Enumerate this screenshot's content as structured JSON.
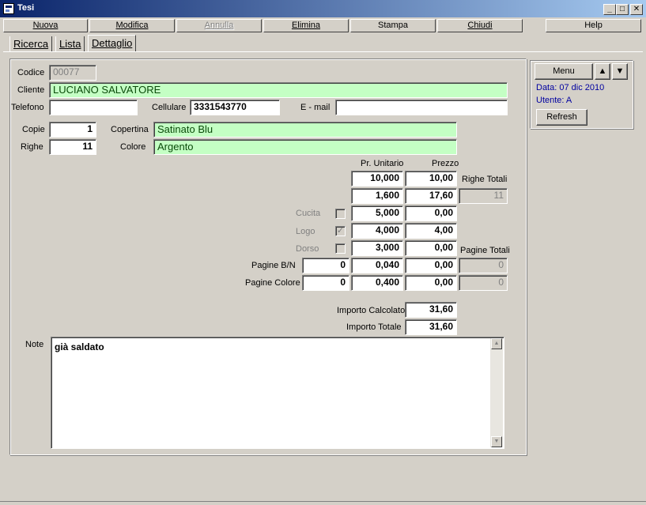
{
  "window": {
    "title": "Tesi",
    "minimize": "_",
    "maximize": "□",
    "close": "✕"
  },
  "toolbar": {
    "nuova": "Nuova",
    "modifica": "Modifica",
    "annulla": "Annulla",
    "elimina": "Elimina",
    "stampa": "Stampa",
    "chiudi": "Chiudi",
    "help": "Help"
  },
  "tabs": [
    "Ricerca",
    "Lista",
    "Dettaglio"
  ],
  "form": {
    "codice_label": "Codice",
    "codice": "00077",
    "cliente_label": "Cliente",
    "cliente": "LUCIANO SALVATORE",
    "telefono_label": "Telefono",
    "telefono": "",
    "cellulare_label": "Cellulare",
    "cellulare": "3331543770",
    "email_label": "E - mail",
    "email": "",
    "copie_label": "Copie",
    "copie": "1",
    "copertina_label": "Copertina",
    "copertina": "Satinato Blu",
    "righe_label": "Righe",
    "righe": "11",
    "colore_label": "Colore",
    "colore": "Argento"
  },
  "pricing": {
    "header_unit": "Pr. Unitario",
    "header_price": "Prezzo",
    "row1_unit": "10,000",
    "row1_price": "10,00",
    "righe_totali_label": "Righe Totali",
    "row2_unit": "1,600",
    "row2_price": "17,60",
    "righe_totali": "11",
    "cucita_label": "Cucita",
    "cucita_checked": false,
    "cucita_unit": "5,000",
    "cucita_price": "0,00",
    "logo_label": "Logo",
    "logo_checked": true,
    "logo_unit": "4,000",
    "logo_price": "4,00",
    "dorso_label": "Dorso",
    "dorso_checked": false,
    "dorso_unit": "3,000",
    "dorso_price": "0,00",
    "pagine_totali_label": "Pagine Totali",
    "pagine_bn_label": "Pagine B/N",
    "pagine_bn_qty": "0",
    "pagine_bn_unit": "0,040",
    "pagine_bn_price": "0,00",
    "pagine_bn_tot": "0",
    "pagine_colore_label": "Pagine Colore",
    "pagine_colore_qty": "0",
    "pagine_colore_unit": "0,400",
    "pagine_colore_price": "0,00",
    "pagine_colore_tot": "0",
    "importo_calcolato_label": "Importo Calcolato",
    "importo_calcolato": "31,60",
    "importo_totale_label": "Importo Totale",
    "importo_totale": "31,60"
  },
  "notes": {
    "label": "Note",
    "text": "già saldato"
  },
  "side": {
    "menu": "Menu",
    "date": "Data: 07 dic 2010",
    "user": "Utente: A",
    "refresh": "Refresh"
  },
  "icons": {
    "up": "arrow-up-icon",
    "down": "arrow-down-icon"
  },
  "glyphs": {
    "check": "✓",
    "arrow_up": "▲",
    "arrow_down": "▼"
  }
}
